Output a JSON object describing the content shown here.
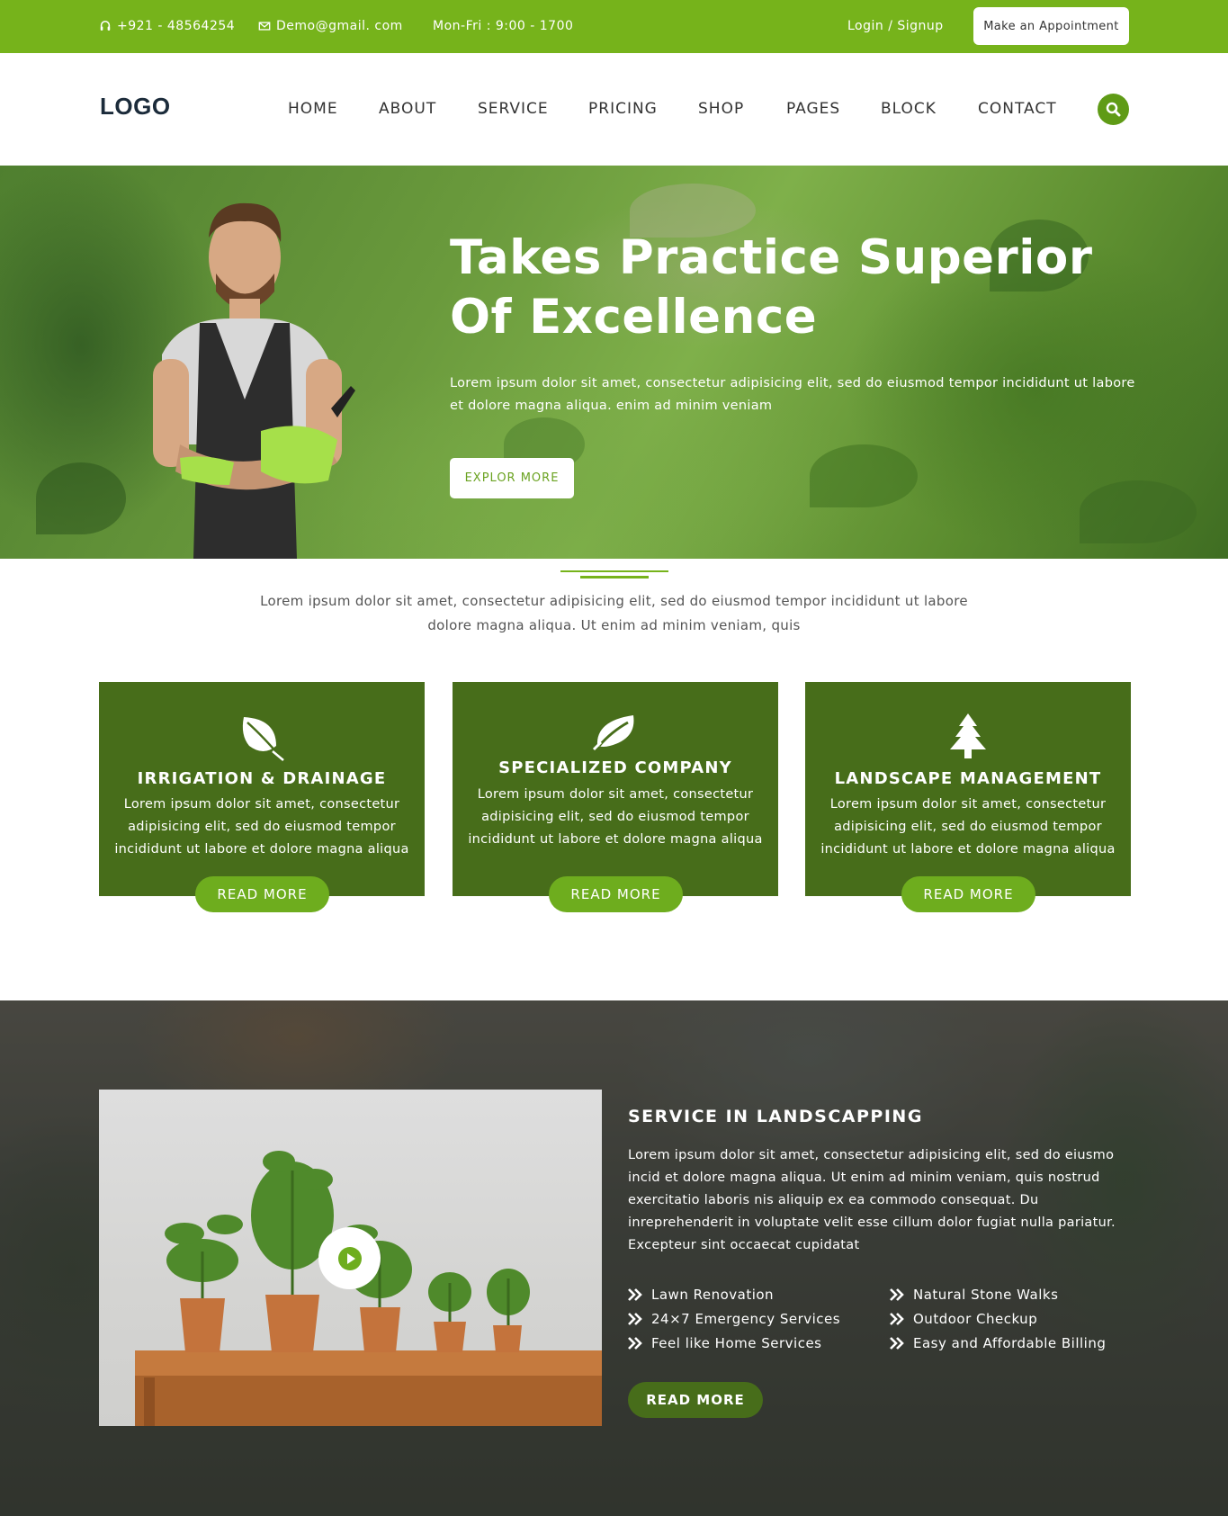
{
  "topbar": {
    "phone": "+921 - 48564254",
    "email": "Demo@gmail. com",
    "hours": "Mon-Fri : 9:00 - 1700",
    "login": "Login / Signup",
    "appointment": "Make an Appointment",
    "phone_icon": "headset-icon",
    "email_icon": "envelope-icon"
  },
  "nav": {
    "logo": "LOGO",
    "items": [
      "HOME",
      "ABOUT",
      "SERVICE",
      "PRICING",
      "SHOP",
      "PAGES",
      "BLOCK",
      "CONTACT"
    ],
    "search_icon": "search-icon"
  },
  "hero": {
    "title_line1": "Takes Practice Superior",
    "title_line2": "Of Excellence",
    "text": "Lorem ipsum dolor sit amet, consectetur adipisicing elit, sed do eiusmod tempor incididunt ut labore et dolore magna aliqua. enim ad minim veniam",
    "button": "EXPLOR MORE"
  },
  "intro": {
    "text": "Lorem ipsum dolor sit amet, consectetur adipisicing elit, sed do eiusmod tempor incididunt ut labore dolore magna aliqua. Ut enim ad minim veniam, quis"
  },
  "cards": [
    {
      "icon": "leaf-icon",
      "title": "IRRIGATION & DRAINAGE",
      "text": "Lorem ipsum dolor sit amet, consectetur adipisicing elit, sed do eiusmod tempor incididunt ut labore et dolore magna aliqua",
      "button": "READ MORE"
    },
    {
      "icon": "leaf-outline-icon",
      "title": "SPECIALIZED COMPANY",
      "text": "Lorem ipsum dolor sit amet, consectetur adipisicing elit, sed do eiusmod tempor incididunt ut labore et dolore magna aliqua",
      "button": "READ MORE"
    },
    {
      "icon": "tree-icon",
      "title": "LANDSCAPE MANAGEMENT",
      "text": "Lorem ipsum dolor sit amet, consectetur adipisicing elit, sed do eiusmod tempor incididunt ut labore et dolore magna aliqua",
      "button": "READ MORE"
    }
  ],
  "landscaping": {
    "title": "SERVICE IN LANDSCAPPING",
    "text": "Lorem ipsum dolor sit amet, consectetur adipisicing elit, sed do eiusmo incid et dolore magna aliqua. Ut enim ad minim veniam, quis nostrud exercitatio laboris nis aliquip ex ea commodo consequat. Du inreprehenderit in voluptate velit esse cillum dolor fugiat nulla pariatur. Excepteur sint occaecat cupidatat",
    "features_left": [
      "Lawn Renovation",
      "24×7 Emergency Services",
      "Feel like Home Services"
    ],
    "features_right": [
      "Natural Stone Walks",
      "Outdoor Checkup",
      "Easy and Affordable Billing"
    ],
    "button": "READ MORE",
    "play_icon": "play-icon"
  },
  "colors": {
    "brand_green": "#76b31b",
    "dark_green": "#476d1a",
    "button_green": "#6ead1e"
  }
}
